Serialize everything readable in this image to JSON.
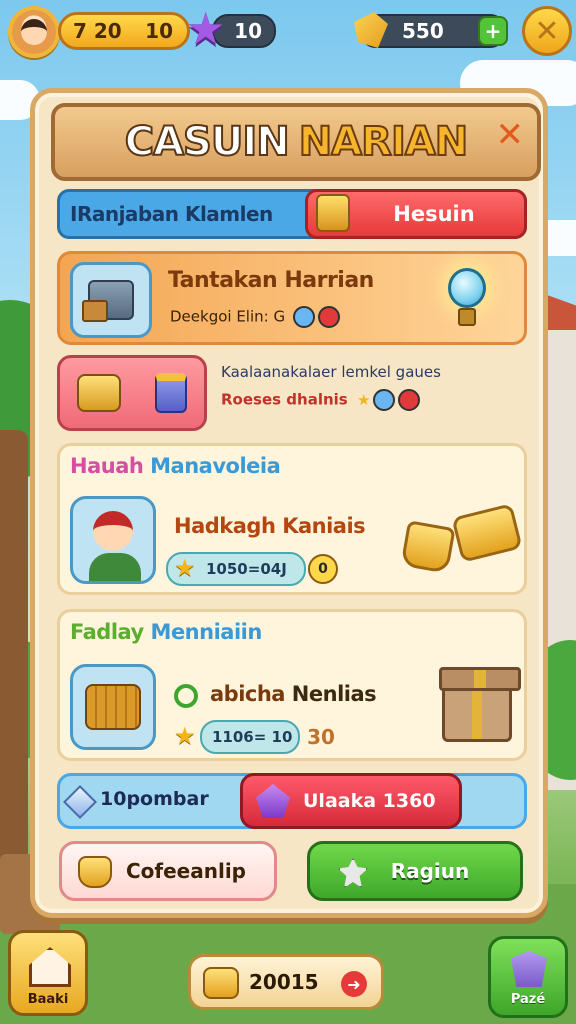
{
  "topbar": {
    "coins_left": "7 20",
    "coins_right": "10",
    "stars": "10",
    "gems": "550",
    "add_symbol": "+",
    "close_symbol": "✕"
  },
  "panel": {
    "title_part1": "CASUIN",
    "title_part2": "NARIAN",
    "close_symbol": "✕",
    "tab_left": "IRanjaban Klamlen",
    "tab_right": "Hesuin",
    "quest": {
      "title": "Tantakan Harrian",
      "subtitle": "Deekgoi Elin: G"
    },
    "row2": {
      "line1": "Kaalaanakalaer lemkel gaues",
      "line2": "Roeses dhalnis"
    },
    "section1": {
      "header_a": "Hauah",
      "header_b": "Manavoleia",
      "title": "Hadkagh Kaniais",
      "progress": "1050=04J",
      "badge": "0"
    },
    "section2": {
      "header_a": "Fadlay",
      "header_b": "Menniaiin",
      "title_a": "abicha",
      "title_b": "Nenlias",
      "progress": "1106= 10",
      "badge": "30"
    },
    "bar": {
      "left": "10pombar",
      "right": "Ulaaka 1360"
    },
    "buttons": {
      "collect": "Cofeeanlip",
      "go": "Ragiun"
    }
  },
  "bottom": {
    "home_label": "Baaki",
    "center_value": "20015",
    "pass_label": "Pazé"
  },
  "colors": {
    "panel_bg": "#f6e6c5",
    "accent_red": "#e63a3a",
    "accent_green": "#3fa82a",
    "accent_blue": "#4aa8e6",
    "gold": "#f3a81d"
  }
}
